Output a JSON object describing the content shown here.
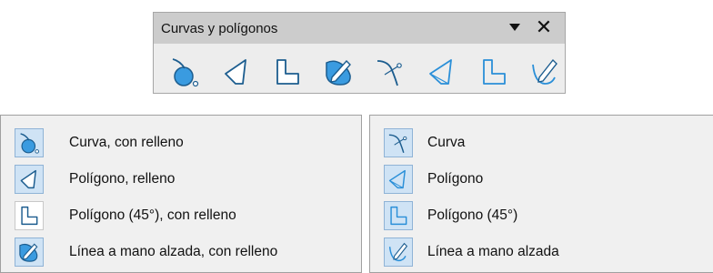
{
  "toolbar": {
    "title": "Curvas y polígonos",
    "menu_icon": "dropdown-triangle-icon",
    "close_icon": "close-icon",
    "close_glyph": "✕",
    "buttons": [
      {
        "icon": "curve-filled-icon"
      },
      {
        "icon": "polygon-filled-icon"
      },
      {
        "icon": "polygon-45-filled-icon"
      },
      {
        "icon": "freeform-line-filled-icon"
      },
      {
        "icon": "curve-icon"
      },
      {
        "icon": "polygon-icon"
      },
      {
        "icon": "polygon-45-icon"
      },
      {
        "icon": "freeform-line-icon"
      }
    ]
  },
  "menu_left": {
    "items": [
      {
        "label": "Curva, con relleno",
        "icon": "curve-filled-icon"
      },
      {
        "label": "Polígono, relleno",
        "icon": "polygon-filled-icon"
      },
      {
        "label": "Polígono (45°), con relleno",
        "icon": "polygon-45-filled-icon"
      },
      {
        "label": "Línea a mano alzada, con relleno",
        "icon": "freeform-line-filled-icon"
      }
    ]
  },
  "menu_right": {
    "items": [
      {
        "label": "Curva",
        "icon": "curve-icon"
      },
      {
        "label": "Polígono",
        "icon": "polygon-icon"
      },
      {
        "label": "Polígono (45°)",
        "icon": "polygon-45-icon"
      },
      {
        "label": "Línea a mano alzada",
        "icon": "freeform-line-icon"
      }
    ]
  },
  "colors": {
    "icon_blue": "#2a8fd8",
    "icon_fill": "#3a9be0",
    "icon_stroke": "#1c5d8f",
    "highlight": "#cfe3f5"
  }
}
